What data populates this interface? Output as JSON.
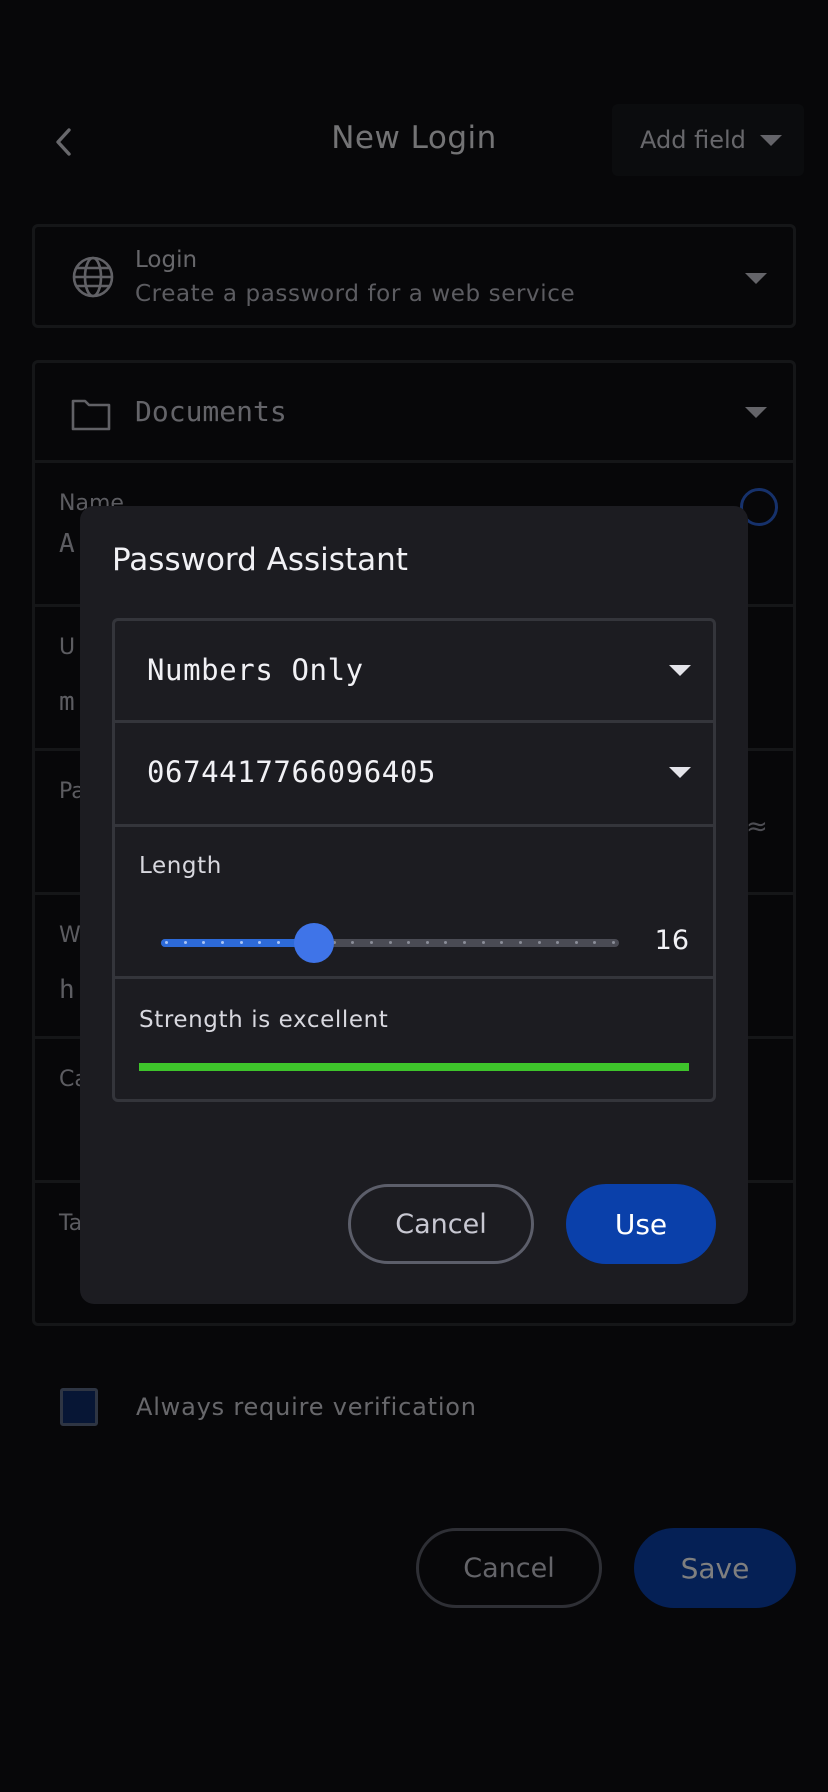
{
  "header": {
    "title": "New Login",
    "add_field_label": "Add field"
  },
  "item_type": {
    "title": "Login",
    "subtitle": "Create a password for a web service"
  },
  "folder": {
    "label": "Documents"
  },
  "form": {
    "rows": [
      {
        "label": "Name",
        "value": "A"
      },
      {
        "label": "U",
        "value": "m"
      },
      {
        "label": "Pa",
        "value": ""
      },
      {
        "label": "W",
        "value": "h"
      },
      {
        "label": "Ca",
        "value": ""
      },
      {
        "label": "Ta",
        "value": ""
      }
    ]
  },
  "verification": {
    "label": "Always require verification",
    "checked": true
  },
  "page_buttons": {
    "cancel": "Cancel",
    "save": "Save"
  },
  "dialog": {
    "title": "Password Assistant",
    "type_value": "Numbers Only",
    "password_value": "0674417766096405",
    "length_label": "Length",
    "length_value": "16",
    "length": 16,
    "length_min": 8,
    "length_max": 32,
    "strength_label": "Strength is excellent",
    "strength_fraction": 1.0,
    "cancel_label": "Cancel",
    "use_label": "Use"
  },
  "colors": {
    "accent": "#0a40aa",
    "slider_blue": "#3f74e8",
    "strength_green": "#3ec42b",
    "dialog_bg": "#1c1c21",
    "page_bg": "#0e0f12"
  },
  "icons": [
    "chevron-left-icon",
    "caret-down-icon",
    "globe-icon",
    "folder-icon"
  ]
}
